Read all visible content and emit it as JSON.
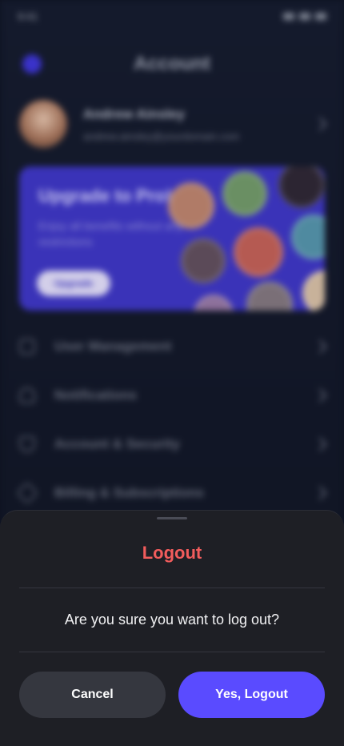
{
  "status_bar": {
    "time": "9:41"
  },
  "header": {
    "title": "Account"
  },
  "profile": {
    "name": "Andrew Ainsley",
    "email": "andrew.ainsley@yourdomain.com"
  },
  "promo": {
    "title": "Upgrade to Pro!",
    "subtitle": "Enjoy all benefits without any restrictions",
    "button_label": "Upgrade"
  },
  "menu": {
    "items": [
      {
        "label": "User Management",
        "icon": "users-icon"
      },
      {
        "label": "Notifications",
        "icon": "bell-icon"
      },
      {
        "label": "Account & Security",
        "icon": "shield-icon"
      },
      {
        "label": "Billing & Subscriptions",
        "icon": "star-icon"
      }
    ]
  },
  "dialog": {
    "title": "Logout",
    "message": "Are you sure you want to log out?",
    "cancel_label": "Cancel",
    "confirm_label": "Yes, Logout"
  },
  "colors": {
    "accent": "#5a4bff",
    "danger": "#f25c5c",
    "sheet_bg": "#1e1f25",
    "page_bg": "#0e1220"
  }
}
